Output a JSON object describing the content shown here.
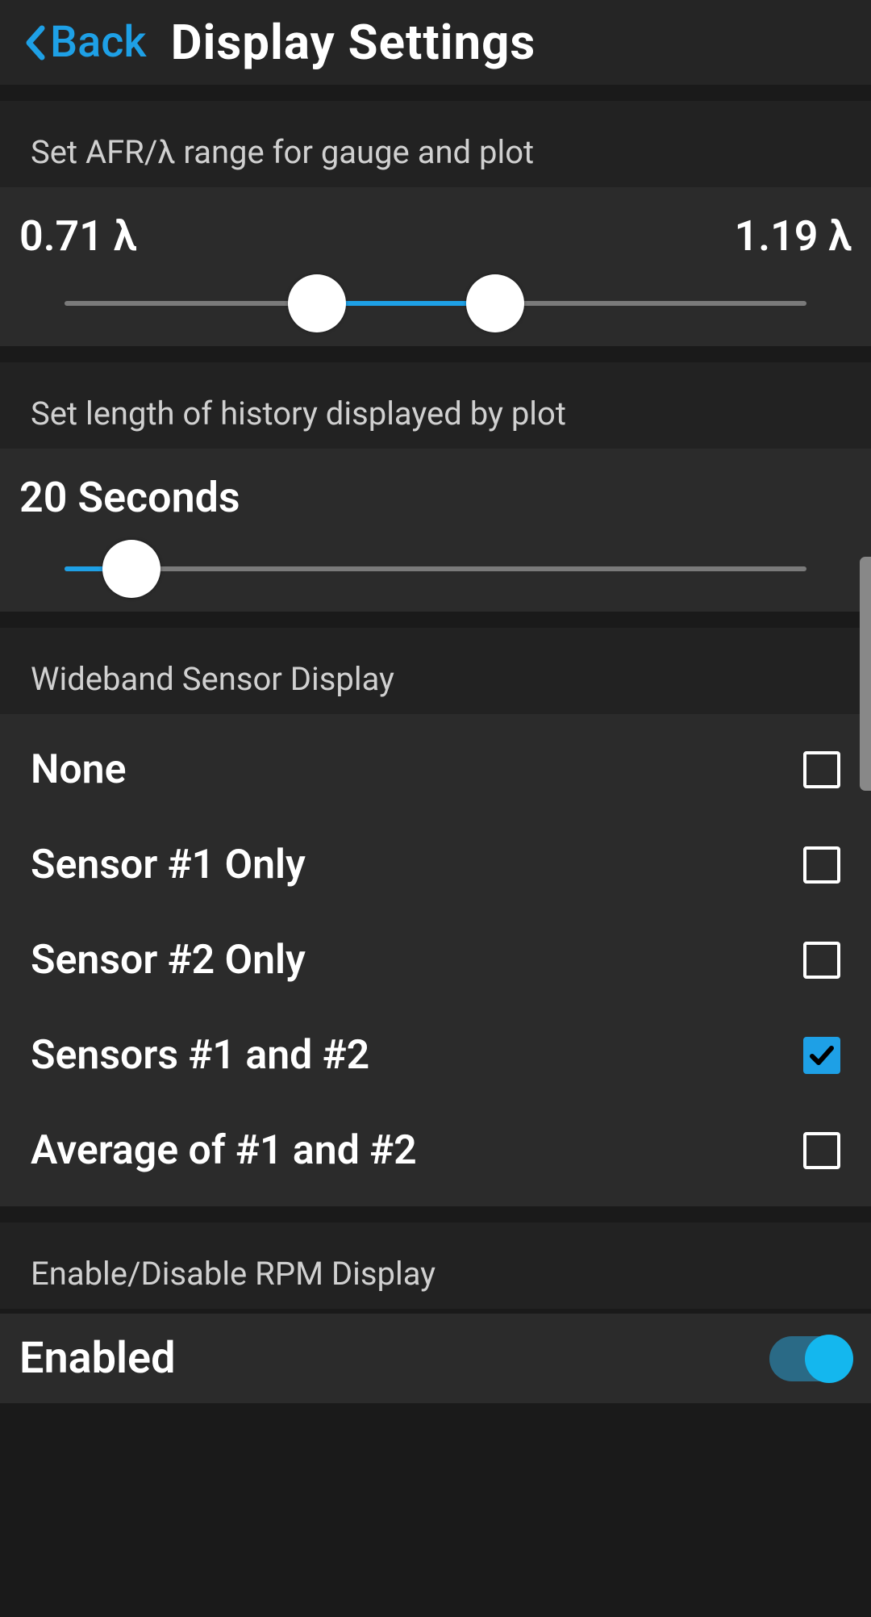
{
  "header": {
    "back_label": "Back",
    "title": "Display Settings"
  },
  "afr_range": {
    "section_label": "Set AFR/λ range for gauge and plot",
    "min_display": "0.71 λ",
    "max_display": "1.19 λ",
    "low_percent": 34,
    "high_percent": 58
  },
  "history": {
    "section_label": "Set length of history displayed by plot",
    "value_display": "20 Seconds",
    "percent": 9
  },
  "wideband": {
    "section_label": "Wideband Sensor Display",
    "options": [
      {
        "label": "None",
        "checked": false
      },
      {
        "label": "Sensor #1 Only",
        "checked": false
      },
      {
        "label": "Sensor #2 Only",
        "checked": false
      },
      {
        "label": "Sensors #1 and #2",
        "checked": true
      },
      {
        "label": "Average of #1 and #2",
        "checked": false
      }
    ]
  },
  "rpm": {
    "section_label": "Enable/Disable RPM Display",
    "toggle_label": "Enabled",
    "enabled": true
  },
  "colors": {
    "accent": "#1ea0e6",
    "bg": "#1a1a1a",
    "panel": "#2b2b2b"
  }
}
